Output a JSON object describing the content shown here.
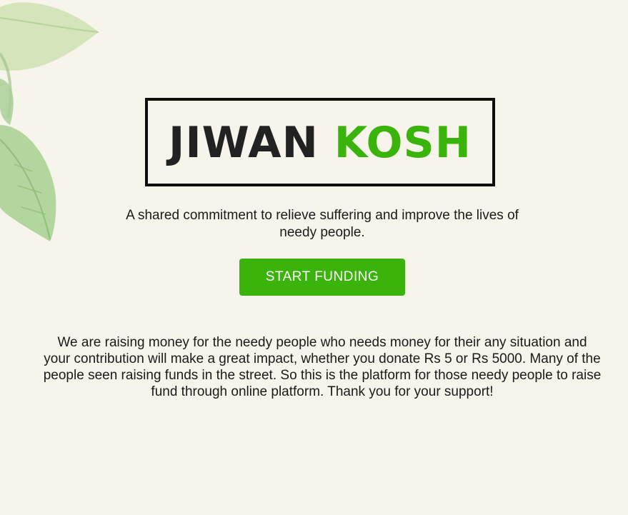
{
  "hero": {
    "logo_word_1": "JIWAN",
    "logo_word_2": "KOSH",
    "tagline": "A shared commitment to relieve suffering and improve the lives of needy people.",
    "cta_label": "START FUNDING"
  },
  "about": {
    "text": "We are raising money for the needy people who needs money for their any situation and your contribution will make a great impact, whether you donate Rs 5 or Rs 5000. Many of the people seen raising funds in the street. So this is the platform for those needy people to raise fund through online platform. Thank you for your support!"
  },
  "colors": {
    "background": "#f7f4ec",
    "accent": "#3ab30a",
    "dark": "#222222"
  },
  "decor": {
    "leaf_icon": "leaf-icon"
  }
}
